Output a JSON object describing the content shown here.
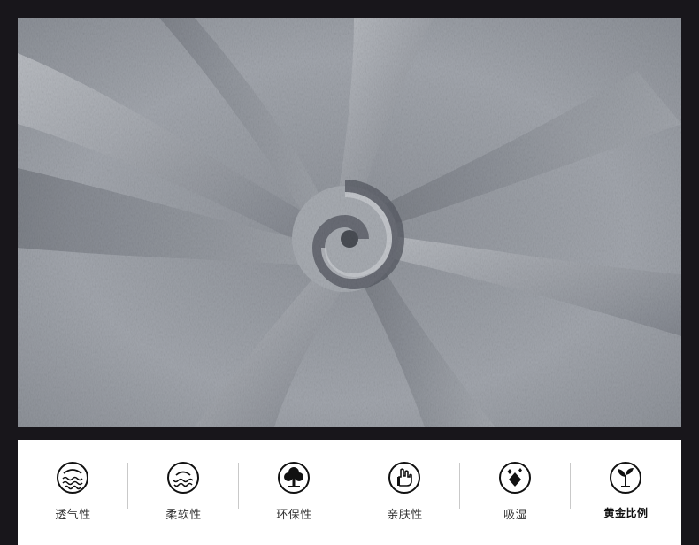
{
  "photo": {
    "subject": "gray-knit-fabric-swirl",
    "colors": {
      "fabric_light": "#c2c5ca",
      "fabric_mid": "#9ea2a9",
      "fabric_dark": "#5f636b"
    }
  },
  "features": [
    {
      "label": "透气性",
      "icon": "breathable-icon"
    },
    {
      "label": "柔软性",
      "icon": "soft-icon"
    },
    {
      "label": "环保性",
      "icon": "eco-tree-icon"
    },
    {
      "label": "亲肤性",
      "icon": "skin-friendly-hand-icon"
    },
    {
      "label": "吸湿",
      "icon": "moisture-absorb-icon"
    },
    {
      "label": "黄金比例",
      "icon": "golden-ratio-sprout-icon"
    }
  ]
}
